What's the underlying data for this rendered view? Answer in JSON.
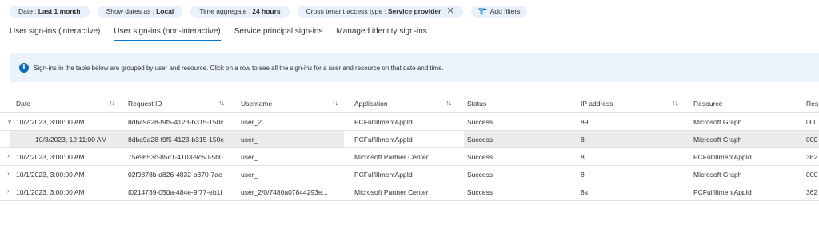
{
  "filters": {
    "date_label": "Date :",
    "date_value": "Last 1 month",
    "show_dates_label": "Show dates as :",
    "show_dates_value": "Local",
    "time_agg_label": "Time aggregate :",
    "time_agg_value": "24 hours",
    "cross_tenant_label": "Cross tenant access type :",
    "cross_tenant_value": "Service provider",
    "add_filters_label": "Add filters"
  },
  "tabs": [
    {
      "label": "User sign-ins (interactive)"
    },
    {
      "label": "User sign-ins (non-interactive)"
    },
    {
      "label": "Service principal sign-ins"
    },
    {
      "label": "Managed identity sign-ins"
    }
  ],
  "banner": {
    "message": "Sign-ins in the table below are grouped by user and resource. Click on a row to see all the sign-ins for a user and resource on that date and time."
  },
  "table": {
    "columns": [
      "Date",
      "Request ID",
      "Username",
      "Application",
      "Status",
      "IP address",
      "Resource",
      "Res"
    ],
    "rows": [
      {
        "chevron": "∨",
        "date": "10/2/2023, 3:00:00 AM",
        "request_id": "8dba9a28-f9f5-4123-b315-150с",
        "username": "user_2",
        "application": "PCFulfillmentAppId",
        "status": "Success",
        "ip": "89",
        "resource": "Microsoft Graph",
        "res": "000"
      },
      {
        "chevron": "",
        "date": "10/3/2023, 12:11:00 AM",
        "request_id": "8dba9a28-f9f5-4123-b315-150с",
        "username": "user_",
        "application": "PCFulfillmentAppId",
        "status": "Success",
        "ip": "8",
        "resource": "Microsoft Graph",
        "res": "000"
      },
      {
        "chevron": "›",
        "date": "10/2/2023, 3:00:00 AM",
        "request_id": "75e9653c-85c1-4103-9c50-5b0",
        "username": "user_",
        "application": "Microsoft Partner Center",
        "status": "Success",
        "ip": "8",
        "resource": "PCFulfillmentAppId",
        "res": "362"
      },
      {
        "chevron": "›",
        "date": "10/1/2023, 3:00:00 AM",
        "request_id": "02f9878b-d826-4832-b370-7ae",
        "username": "user_",
        "application": "PCFulfillmentAppId",
        "status": "Success",
        "ip": "8",
        "resource": "Microsoft Graph",
        "res": "000"
      },
      {
        "chevron": "›",
        "date": "10/1/2023, 3:00:00 AM",
        "request_id": "f0214739-050a-484e-9f77-eb1f",
        "username": "user_2/0/7480a07844293e...",
        "application": "Microsoft Partner Center",
        "status": "Success",
        "ip": "8s",
        "resource": "PCFulfillmentAppId",
        "res": "362"
      }
    ]
  },
  "icons": {
    "info": "info-icon",
    "sort": "sort-icon",
    "filter_add": "filter-add-icon",
    "close": "close-icon"
  },
  "colors": {
    "accent": "#0078d4",
    "pill_bg": "#e8f0fb",
    "banner_bg": "#ebf3fc",
    "selected_row": "#ebebeb"
  }
}
